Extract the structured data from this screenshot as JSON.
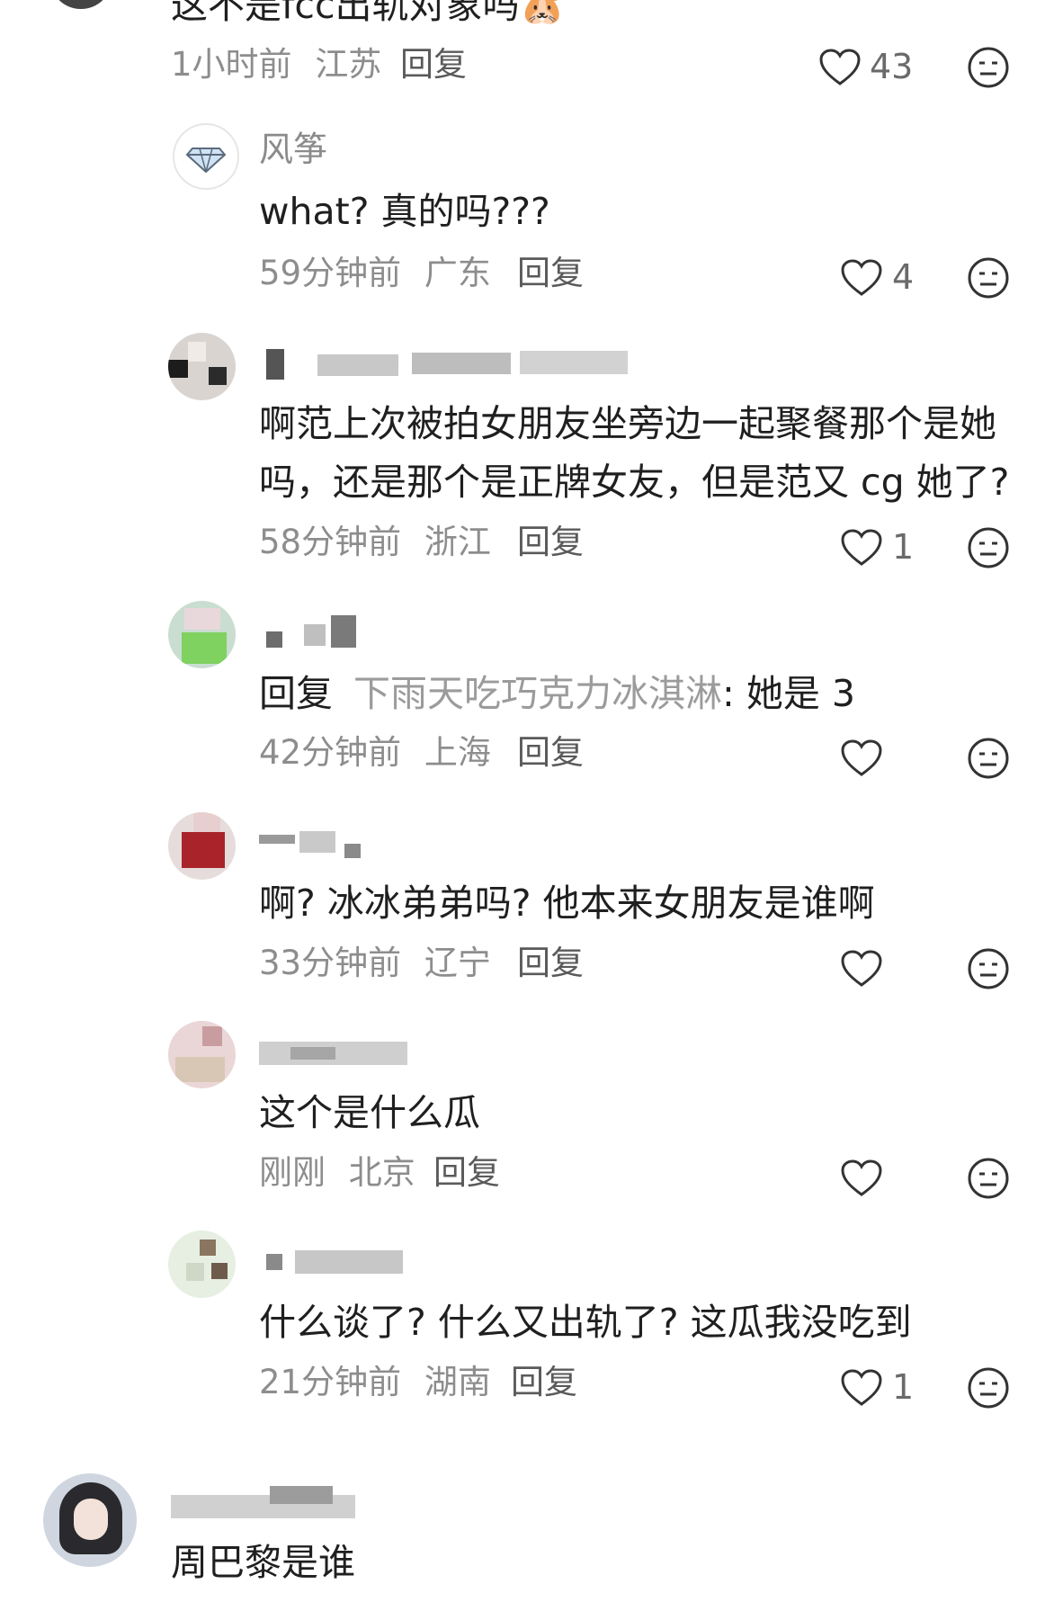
{
  "comments": {
    "top_partial": {
      "text": "这不是fcc出轨对象吗🐹",
      "time": "1小时前",
      "location": "江苏",
      "reply_label": "回复",
      "likes": "43"
    },
    "replies": [
      {
        "username": "风筝",
        "text": "what? 真的吗???",
        "time": "59分钟前",
        "location": "广东",
        "reply_label": "回复",
        "likes": "4"
      },
      {
        "username": "",
        "text_line1": "啊范上次被拍女朋友坐旁边一起聚餐那个是她",
        "text_line2": "吗，还是那个是正牌女友，但是范又 cg 她了?",
        "time": "58分钟前",
        "location": "浙江",
        "reply_label": "回复",
        "likes": "1"
      },
      {
        "username": "",
        "reply_prefix": "回复",
        "reply_to": "下雨天吃巧克力冰淇淋",
        "text": ": 她是 3",
        "time": "42分钟前",
        "location": "上海",
        "reply_label": "回复",
        "likes": ""
      },
      {
        "username": "",
        "text": "啊? 冰冰弟弟吗? 他本来女朋友是谁啊",
        "time": "33分钟前",
        "location": "辽宁",
        "reply_label": "回复",
        "likes": ""
      },
      {
        "username": "",
        "text": "这个是什么瓜",
        "time": "刚刚",
        "location": "北京",
        "reply_label": "回复",
        "likes": ""
      },
      {
        "username": "",
        "text": "什么谈了? 什么又出轨了? 这瓜我没吃到",
        "time": "21分钟前",
        "location": "湖南",
        "reply_label": "回复",
        "likes": "1"
      }
    ],
    "bottom_partial": {
      "username": "",
      "text": "周巴黎是谁"
    }
  },
  "icons": {
    "like": "heart-outline-icon",
    "dislike": "meh-face-icon",
    "verified": "diamond-icon"
  },
  "colors": {
    "text": "#1f1f1f",
    "meta": "#8d8d8d",
    "icon": "#333333"
  }
}
